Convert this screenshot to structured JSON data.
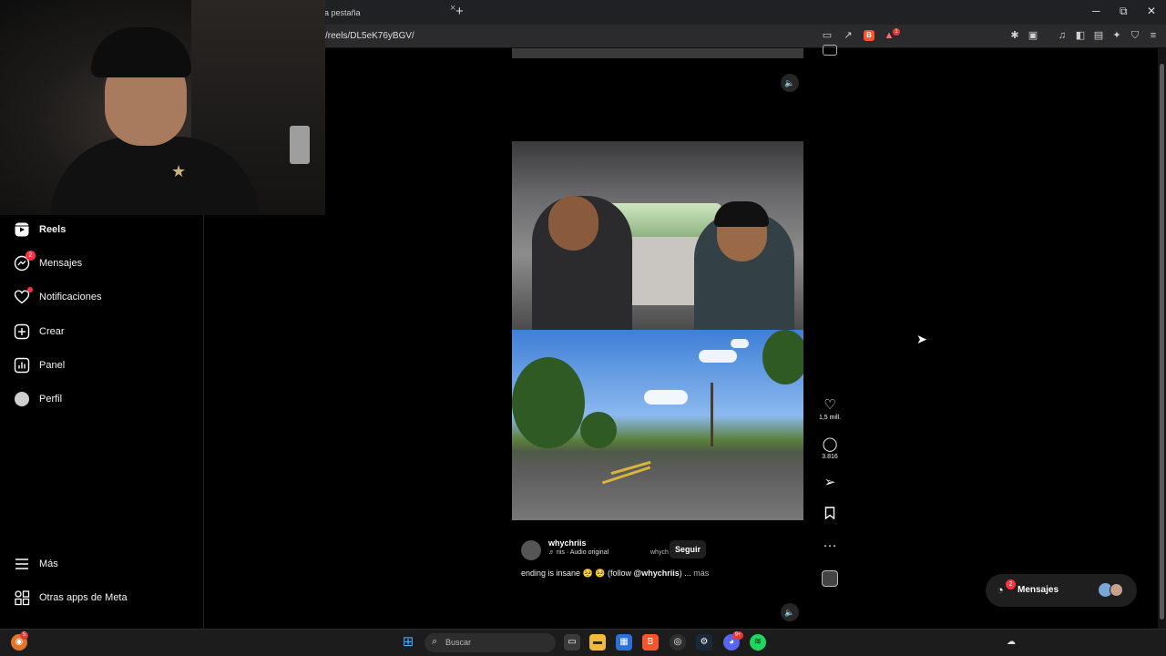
{
  "browser": {
    "tab_title": "a pestaña",
    "tab_close": "×",
    "new_tab": "+",
    "url": "/reels/DL5eK76yBGV/",
    "window": {
      "minimize": "─",
      "restore": "⧉",
      "close": "✕"
    },
    "shields_badge": "1"
  },
  "sidebar": {
    "items": [
      {
        "label": "Reels",
        "icon": "reels-icon"
      },
      {
        "label": "Mensajes",
        "icon": "messenger-icon",
        "badge": "2"
      },
      {
        "label": "Notificaciones",
        "icon": "heart-icon"
      },
      {
        "label": "Crear",
        "icon": "plus-square-icon"
      },
      {
        "label": "Panel",
        "icon": "dashboard-icon"
      },
      {
        "label": "Perfil",
        "icon": "avatar"
      },
      {
        "label": "Más",
        "icon": "menu-icon"
      },
      {
        "label": "Otras apps de Meta",
        "icon": "meta-apps-icon"
      }
    ]
  },
  "reel": {
    "likes": "1,5 mill.",
    "comments": "3.816",
    "author": "whychriis",
    "audio": "♬ riis · Audio original",
    "author_ghost": "whych",
    "follow": "Seguir",
    "caption_text": "ending is insane 🥺 🥺 (follow ",
    "caption_handle": "@whychriis",
    "caption_close": ") ...",
    "caption_more": "más"
  },
  "messages_bubble": {
    "label": "Mensajes",
    "badge": "2"
  },
  "taskbar": {
    "search_placeholder": "Buscar",
    "firefox_badge": "5",
    "discord_badge": "9+"
  }
}
